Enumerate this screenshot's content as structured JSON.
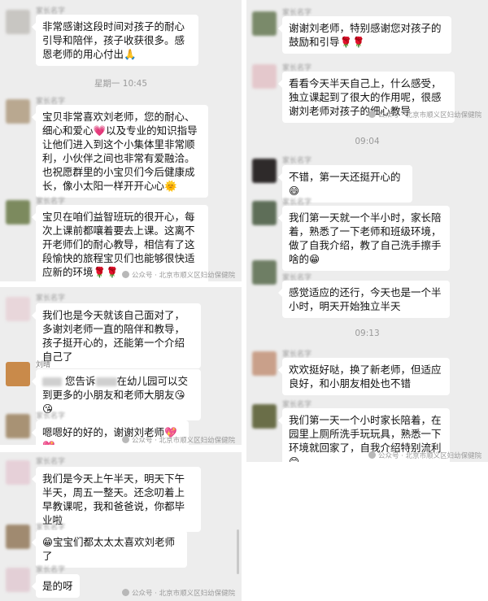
{
  "panel1": {
    "m1": {
      "sender": "家长名字",
      "text": "非常感谢这段时间对孩子的耐心引导和陪伴，孩子收获很多。感恩老师的用心付出🙏"
    },
    "time": "星期一 10:45",
    "m2": {
      "sender": "家长名字",
      "text": "宝贝非常喜欢刘老师，您的耐心、细心和爱心💗以及专业的知识指导让他们进入到这个小集体里非常顺利，小伙伴之间也非常有爱融洽。也祝愿群里的小宝贝们今后健康成长，像小太阳一样开开心心🌞"
    },
    "m3": {
      "sender": "家长名字",
      "text": "宝贝在咱们益智班玩的很开心，每次上课前都嚷着要去上课。这离不开老师们的耐心教导，相信有了这段愉快的旅程宝贝们也能够很快适应新的环境🌹🌹"
    },
    "watermark": "公众号 · 北京市顺义区妇幼保健院"
  },
  "panel2": {
    "m1": {
      "sender": "家长名字",
      "text": "我们也是今天就该自己面对了，多谢刘老师一直的陪伴和教导，孩子挺开心的，还能第一个介绍自己了"
    },
    "m2": {
      "sender": "刘晴",
      "text_a": "您告诉",
      "text_b": "在幼儿园可以交到更多的小朋友和老师大朋友😘😘"
    },
    "m3": {
      "sender": "家长名字",
      "text": "嗯嗯好的好的，谢谢刘老师💖💖"
    },
    "watermark": "公众号 · 北京市顺义区妇幼保健院"
  },
  "panel3": {
    "m1": {
      "sender": "家长名字",
      "text": "我们是今天上午半天，明天下午半天，周五一整天。还念叨着上早教课呢，我和爸爸说，你都毕业啦"
    },
    "m2": {
      "sender": "家长名字",
      "text": "😁宝宝们都太太太喜欢刘老师了"
    },
    "m3": {
      "sender": "家长名字",
      "text": "是的呀"
    },
    "watermark": "公众号 · 北京市顺义区妇幼保健院"
  },
  "panel4": {
    "m1": {
      "sender": "家长名字",
      "text": "谢谢刘老师，特别感谢您对孩子的鼓励和引导🌹🌹"
    },
    "m2": {
      "sender": "家长名字",
      "text": "看看今天半天自己上，什么感受，独立课起到了很大的作用呢，很感谢刘老师对孩子的细心教导"
    },
    "watermark1": "公众号 · 北京市顺义区妇幼保健院",
    "time1": "09:04",
    "m3": {
      "sender": "家长名字",
      "text": "不错，第一天还挺开心的😄"
    },
    "m4": {
      "sender": "家长名字",
      "text": "我们第一天就一个半小时，家长陪着，熟悉了一下老师和班级环境，做了自我介绍，教了自己洗手擦手啥的😁"
    },
    "m5": {
      "sender": "家长名字",
      "text": "感觉适应的还行，今天也是一个半小时，明天开始独立半天"
    },
    "time2": "09:13",
    "m6": {
      "sender": "家长名字",
      "text": "欢欢挺好哒，换了新老师，但适应良好，和小朋友相处也不错"
    },
    "m7": {
      "sender": "家长名字",
      "text": "我们第一天一个小时家长陪着，在园里上厕所洗手玩玩具，熟悉一下环境就回家了，自我介绍特别流利😊"
    },
    "watermark2": "公众号 · 北京市顺义区妇幼保健院"
  },
  "colors": {
    "chat_bg": "#ededed",
    "bubble": "#ffffff",
    "meta": "#9a9a9a"
  }
}
